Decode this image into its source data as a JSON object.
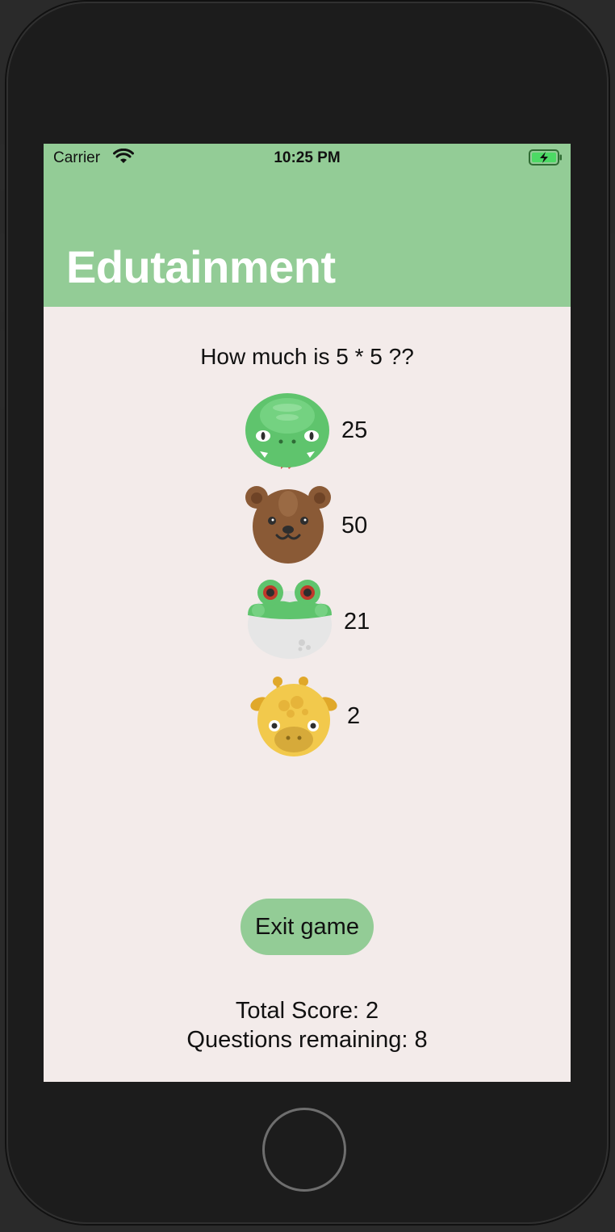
{
  "status_bar": {
    "carrier": "Carrier",
    "time": "10:25 PM"
  },
  "nav": {
    "title": "Edutainment"
  },
  "question": "How much is 5 * 5 ??",
  "answers": [
    {
      "animal": "snake",
      "icon": "snake-icon",
      "label": "25"
    },
    {
      "animal": "bear",
      "icon": "bear-icon",
      "label": "50"
    },
    {
      "animal": "frog",
      "icon": "frog-icon",
      "label": "21"
    },
    {
      "animal": "giraffe",
      "icon": "giraffe-icon",
      "label": "2"
    }
  ],
  "exit_button": "Exit game",
  "score": {
    "total": "Total Score: 2",
    "remaining": "Questions remaining: 8"
  },
  "colors": {
    "accent": "#93cc96",
    "background": "#f3ebea",
    "title_text": "#ffffff"
  }
}
